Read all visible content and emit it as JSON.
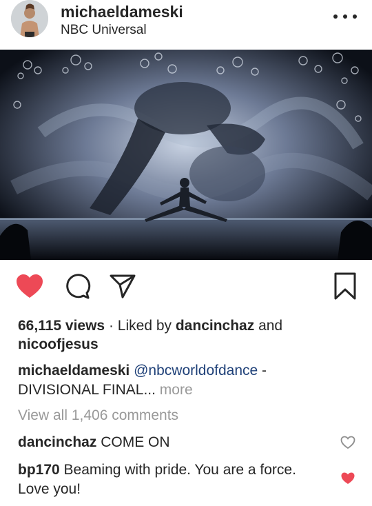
{
  "post": {
    "username": "michaeldameski",
    "location": "NBC Universal",
    "more_icon": "more-horizontal-icon"
  },
  "media": {
    "description_icon": "dance-performance-video"
  },
  "actions": {
    "like_icon": "heart-filled-icon",
    "like_color": "#ed4956",
    "comment_icon": "comment-icon",
    "share_icon": "share-paper-plane-icon",
    "save_icon": "bookmark-icon"
  },
  "stats": {
    "views": "66,115 views",
    "separator": " · ",
    "liked_by_prefix": "Liked by ",
    "liked_by_user1": "dancinchaz",
    "liked_by_and": " and",
    "liked_by_user2": "nicoofjesus"
  },
  "caption": {
    "author": "michaeldameski",
    "mention": "@nbcworldofdance",
    "text": " - DIVISIONAL FINAL...",
    "more": "more"
  },
  "comments_link": "View all 1,406 comments",
  "comments": [
    {
      "user": "dancinchaz",
      "text": "COME ON",
      "liked": false
    },
    {
      "user": "bp170",
      "text": "Beaming with pride. You are a force. Love you!",
      "liked": true
    }
  ]
}
